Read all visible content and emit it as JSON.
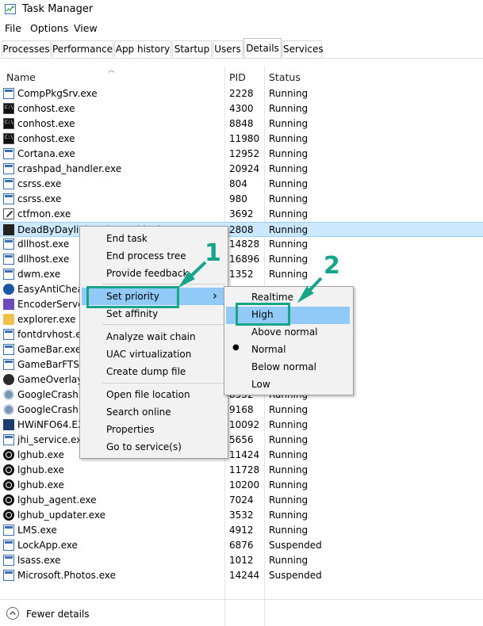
{
  "window": {
    "title": "Task Manager"
  },
  "menubar": [
    "File",
    "Options",
    "View"
  ],
  "tabs": [
    "Processes",
    "Performance",
    "App history",
    "Startup",
    "Users",
    "Details",
    "Services"
  ],
  "active_tab": "Details",
  "columns": {
    "name": "Name",
    "pid": "PID",
    "status": "Status"
  },
  "rows": [
    {
      "name": "CompPkgSrv.exe",
      "pid": "2228",
      "status": "Running",
      "icon": "window-icon"
    },
    {
      "name": "conhost.exe",
      "pid": "4300",
      "status": "Running",
      "icon": "console-icon"
    },
    {
      "name": "conhost.exe",
      "pid": "8848",
      "status": "Running",
      "icon": "console-icon"
    },
    {
      "name": "conhost.exe",
      "pid": "11980",
      "status": "Running",
      "icon": "console-icon"
    },
    {
      "name": "Cortana.exe",
      "pid": "12952",
      "status": "Running",
      "icon": "window-icon"
    },
    {
      "name": "crashpad_handler.exe",
      "pid": "20924",
      "status": "Running",
      "icon": "window-icon"
    },
    {
      "name": "csrss.exe",
      "pid": "804",
      "status": "Running",
      "icon": "window-icon"
    },
    {
      "name": "csrss.exe",
      "pid": "980",
      "status": "Running",
      "icon": "window-icon"
    },
    {
      "name": "ctfmon.exe",
      "pid": "3692",
      "status": "Running",
      "icon": "pen-icon"
    },
    {
      "name": "DeadByDaylight-Win64-Shipping.exe",
      "pid": "2808",
      "status": "Running",
      "icon": "game-icon"
    },
    {
      "name": "dllhost.exe",
      "pid": "14828",
      "status": "Running",
      "icon": "window-icon"
    },
    {
      "name": "dllhost.exe",
      "pid": "16896",
      "status": "Running",
      "icon": "window-icon"
    },
    {
      "name": "dwm.exe",
      "pid": "1352",
      "status": "Running",
      "icon": "window-icon"
    },
    {
      "name": "EasyAntiCheat.exe",
      "pid": "",
      "status": "",
      "icon": "anticheat-icon"
    },
    {
      "name": "EncoderServer.exe",
      "pid": "",
      "status": "",
      "icon": "encoder-icon"
    },
    {
      "name": "explorer.exe",
      "pid": "",
      "status": "",
      "icon": "folder-icon"
    },
    {
      "name": "fontdrvhost.exe",
      "pid": "",
      "status": "",
      "icon": "window-icon"
    },
    {
      "name": "GameBar.exe",
      "pid": "",
      "status": "",
      "icon": "window-icon"
    },
    {
      "name": "GameBarFTServer.exe",
      "pid": "",
      "status": "",
      "icon": "window-icon"
    },
    {
      "name": "GameOverlayUI.exe",
      "pid": "",
      "status": "",
      "icon": "xbox-icon"
    },
    {
      "name": "GoogleCrashHandler.exe",
      "pid": "8552",
      "status": "Running",
      "icon": "gear-icon"
    },
    {
      "name": "GoogleCrashHandler64.exe",
      "pid": "9168",
      "status": "Running",
      "icon": "gear-icon"
    },
    {
      "name": "HWiNFO64.EXE",
      "pid": "10092",
      "status": "Running",
      "icon": "hwinfo-icon"
    },
    {
      "name": "jhi_service.exe",
      "pid": "5656",
      "status": "Running",
      "icon": "window-icon"
    },
    {
      "name": "lghub.exe",
      "pid": "11424",
      "status": "Running",
      "icon": "logitech-icon"
    },
    {
      "name": "lghub.exe",
      "pid": "11728",
      "status": "Running",
      "icon": "logitech-icon"
    },
    {
      "name": "lghub.exe",
      "pid": "10200",
      "status": "Running",
      "icon": "logitech-icon"
    },
    {
      "name": "lghub_agent.exe",
      "pid": "7024",
      "status": "Running",
      "icon": "logitech-icon"
    },
    {
      "name": "lghub_updater.exe",
      "pid": "3532",
      "status": "Running",
      "icon": "logitech-icon"
    },
    {
      "name": "LMS.exe",
      "pid": "4912",
      "status": "Running",
      "icon": "window-icon"
    },
    {
      "name": "LockApp.exe",
      "pid": "6876",
      "status": "Suspended",
      "icon": "window-icon"
    },
    {
      "name": "lsass.exe",
      "pid": "1012",
      "status": "Running",
      "icon": "window-icon"
    },
    {
      "name": "Microsoft.Photos.exe",
      "pid": "14244",
      "status": "Suspended",
      "icon": "window-icon"
    }
  ],
  "selected_row_index": 9,
  "context_menu": {
    "group1": [
      "End task",
      "End process tree",
      "Provide feedback"
    ],
    "group2": [
      "Set priority",
      "Set affinity"
    ],
    "group3": [
      "Analyze wait chain",
      "UAC virtualization",
      "Create dump file"
    ],
    "group4": [
      "Open file location",
      "Search online",
      "Properties",
      "Go to service(s)"
    ],
    "submenu_arrow": "›"
  },
  "priority_submenu": {
    "items": [
      "Realtime",
      "High",
      "Above normal",
      "Normal",
      "Below normal",
      "Low"
    ],
    "checked": "Normal",
    "highlighted": "High",
    "bullet": "●"
  },
  "callouts": {
    "one": "1",
    "two": "2"
  },
  "footer": {
    "fewer_details": "Fewer details"
  },
  "colors": {
    "annotation": "#17a589",
    "selection": "#cce8ff",
    "menu_highlight": "#91c9f7"
  }
}
